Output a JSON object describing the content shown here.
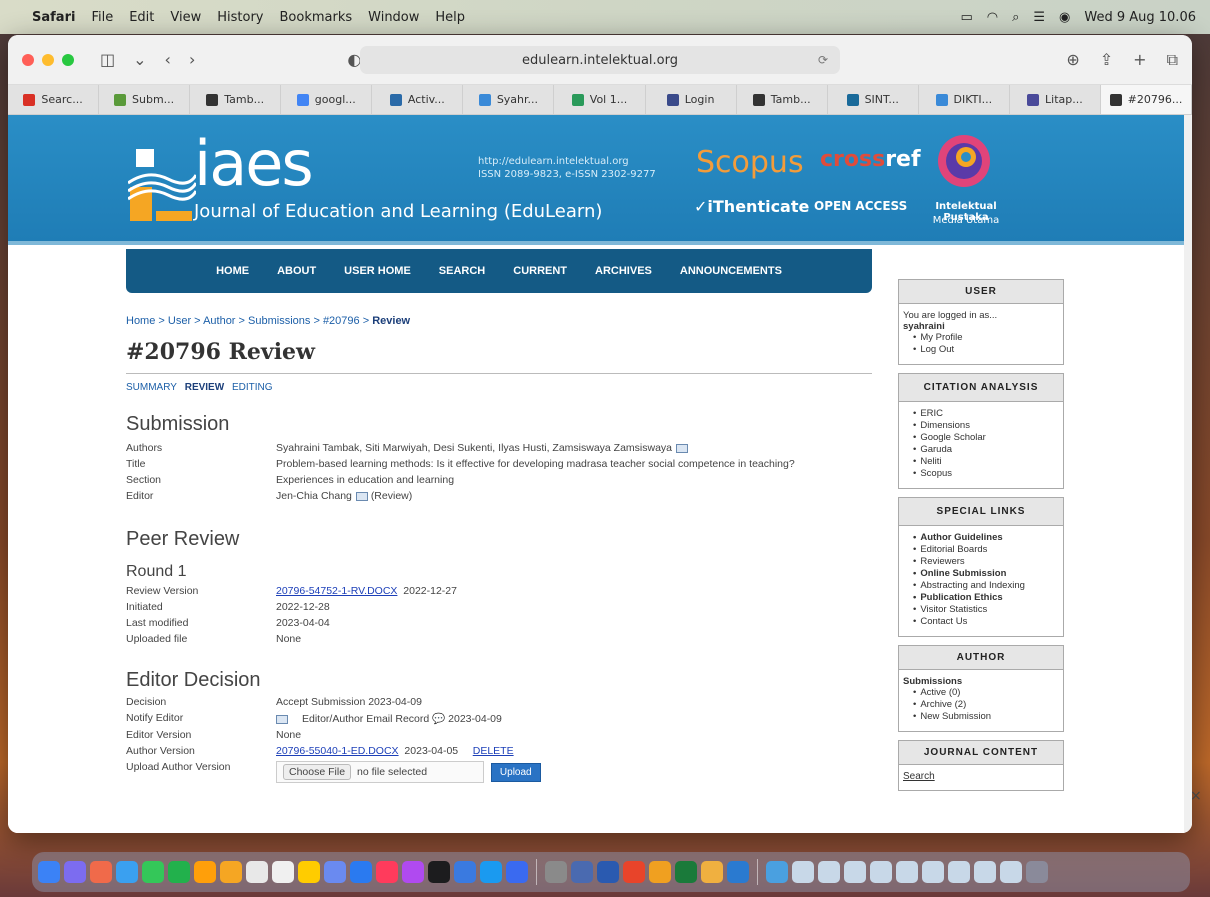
{
  "menubar": {
    "app": "Safari",
    "items": [
      "File",
      "Edit",
      "View",
      "History",
      "Bookmarks",
      "Window",
      "Help"
    ],
    "clock": "Wed 9 Aug 10.06"
  },
  "browser": {
    "url": "edulearn.intelektual.org",
    "tabs": [
      {
        "label": "Searc...",
        "icon": "gmail-icon",
        "color": "#d93025"
      },
      {
        "label": "Subm...",
        "icon": "shield-favicon",
        "color": "#5a9a3a"
      },
      {
        "label": "Tamb...",
        "icon": "pkp-favicon",
        "color": "#333333"
      },
      {
        "label": "googl...",
        "icon": "google-icon",
        "color": "#4285f4"
      },
      {
        "label": "Activ...",
        "icon": "activity-favicon",
        "color": "#2a6aa8"
      },
      {
        "label": "Syahr...",
        "icon": "syahr-favicon",
        "color": "#3a8ad8"
      },
      {
        "label": "Vol 1...",
        "icon": "vol-favicon",
        "color": "#2a9a5a"
      },
      {
        "label": "Login",
        "icon": "login-favicon",
        "color": "#3a4a8a"
      },
      {
        "label": "Tamb...",
        "icon": "pkp-favicon",
        "color": "#333333"
      },
      {
        "label": "SINT...",
        "icon": "sinta-favicon",
        "color": "#1a6a9a"
      },
      {
        "label": "DIKTI...",
        "icon": "dikti-favicon",
        "color": "#3a8ad8"
      },
      {
        "label": "Litap...",
        "icon": "litap-favicon",
        "color": "#4a4a9a"
      },
      {
        "label": "#20796...",
        "icon": "pkp-favicon",
        "color": "#333333"
      }
    ]
  },
  "banner": {
    "logo": "iaes",
    "journal": "Journal of Education and Learning (EduLearn)",
    "url_line": "http://edulearn.intelektual.org",
    "issn_line": "ISSN 2089-9823, e-ISSN 2302-9277",
    "scopus": "Scopus",
    "crossref_a": "cross",
    "crossref_b": "ref",
    "ithenticate": "iThenticate",
    "open_access": "OPEN ACCESS",
    "publisher": "Intelektual Pustaka",
    "publisher_sub": "Media Utama"
  },
  "nav": [
    "HOME",
    "ABOUT",
    "USER HOME",
    "SEARCH",
    "CURRENT",
    "ARCHIVES",
    "ANNOUNCEMENTS"
  ],
  "breadcrumb": {
    "items": [
      "Home",
      "User",
      "Author",
      "Submissions",
      "#20796"
    ],
    "current": "Review"
  },
  "page_title": "#20796 Review",
  "subtabs": [
    "SUMMARY",
    "REVIEW",
    "EDITING"
  ],
  "submission": {
    "heading": "Submission",
    "rows": [
      {
        "label": "Authors",
        "value": "Syahraini Tambak, Siti Marwiyah, Desi Sukenti, Ilyas Husti, Zamsiswaya Zamsiswaya"
      },
      {
        "label": "Title",
        "value": "Problem-based learning methods: Is it effective for developing madrasa teacher social competence in teaching?"
      },
      {
        "label": "Section",
        "value": "Experiences in education and learning"
      },
      {
        "label": "Editor",
        "value": "Jen-Chia Chang",
        "suffix": "(Review)"
      }
    ]
  },
  "peer_review": {
    "heading": "Peer Review",
    "round": "Round 1",
    "rows": [
      {
        "label": "Review Version",
        "link": "20796-54752-1-RV.DOCX",
        "value": "2022-12-27"
      },
      {
        "label": "Initiated",
        "value": "2022-12-28"
      },
      {
        "label": "Last modified",
        "value": "2023-04-04"
      },
      {
        "label": "Uploaded file",
        "value": "None"
      }
    ]
  },
  "editor_decision": {
    "heading": "Editor Decision",
    "decision_label": "Decision",
    "decision_value": "Accept Submission 2023-04-09",
    "notify_label": "Notify Editor",
    "notify_value": "Editor/Author Email Record",
    "notify_date": "2023-04-09",
    "editor_version_label": "Editor Version",
    "editor_version_value": "None",
    "author_version_label": "Author Version",
    "author_version_link": "20796-55040-1-ED.DOCX",
    "author_version_date": "2023-04-05",
    "delete_label": "DELETE",
    "upload_label": "Upload Author Version",
    "choose_file": "Choose File",
    "no_file": "no file selected",
    "upload_button": "Upload"
  },
  "sidebar": {
    "user": {
      "title": "USER",
      "logged_in_as": "You are logged in as...",
      "username": "syahraini",
      "links": [
        "My Profile",
        "Log Out"
      ]
    },
    "citation": {
      "title": "CITATION ANALYSIS",
      "links": [
        "ERIC",
        "Dimensions",
        "Google Scholar",
        "Garuda",
        "Neliti",
        "Scopus"
      ]
    },
    "special": {
      "title": "SPECIAL LINKS",
      "links": [
        {
          "label": "Author Guidelines",
          "bold": true
        },
        {
          "label": "Editorial Boards",
          "bold": false
        },
        {
          "label": "Reviewers",
          "bold": false
        },
        {
          "label": "Online Submission",
          "bold": true
        },
        {
          "label": "Abstracting and Indexing",
          "bold": false
        },
        {
          "label": "Publication Ethics",
          "bold": true
        },
        {
          "label": "Visitor Statistics",
          "bold": false
        },
        {
          "label": "Contact Us",
          "bold": false
        }
      ]
    },
    "author": {
      "title": "AUTHOR",
      "sub": "Submissions",
      "links": [
        "Active (0)",
        "Archive (2)",
        "New Submission"
      ]
    },
    "journal": {
      "title": "JOURNAL CONTENT",
      "search": "Search"
    }
  },
  "dock_colors": [
    "#3b82f6",
    "#7c6cf0",
    "#f06a4a",
    "#3aa0f0",
    "#34c759",
    "#22b14c",
    "#ff9f0a",
    "#f5a623",
    "#e8e8e8",
    "#f0f0f0",
    "#ffcc00",
    "#6a8af0",
    "#2a7af0",
    "#ff3b5c",
    "#b04af0",
    "#1c1c1e",
    "#3a7ae0",
    "#1a9af0",
    "#3a6af0",
    "#8a8a8a",
    "#4a6ab0",
    "#2a5ab0",
    "#e8442a",
    "#f0a020",
    "#1a7a3a",
    "#f0b040",
    "#2a7ad0",
    "#4aa0e0",
    "#c8d8e8",
    "#c8d8e8",
    "#c8d8e8",
    "#c8d8e8",
    "#c8d8e8",
    "#c8d8e8",
    "#c8d8e8",
    "#c8d8e8",
    "#c8d8e8",
    "#8a8a9a"
  ]
}
